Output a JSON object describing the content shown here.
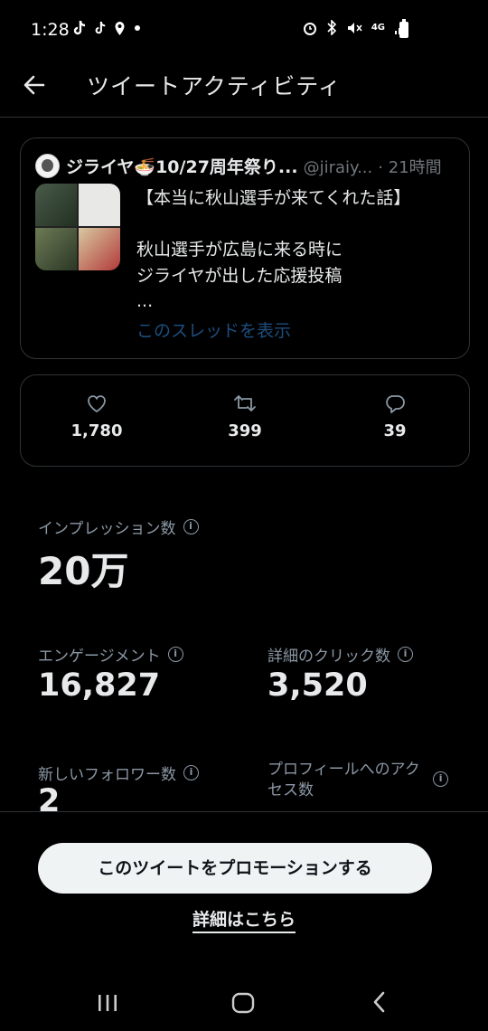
{
  "status_bar": {
    "time": "1:28",
    "left_icons": [
      "tiktok-icon",
      "tiktok-icon",
      "location-icon",
      "dot-icon"
    ],
    "right_icons": [
      "alarm-icon",
      "bluetooth-icon",
      "mute-icon",
      "4g-icon",
      "signal-icon",
      "battery-icon"
    ],
    "network": "4G"
  },
  "header": {
    "title": "ツイートアクティビティ"
  },
  "tweet": {
    "display_name": "ジライヤ🍜10/27周年祭り...",
    "handle": "@jiraiy...",
    "time": "· 21時間",
    "text": "【本当に秋山選手が来てくれた話】\n\n秋山選手が広島に来る時に\nジライヤが出した応援投稿\n...",
    "show_thread": "このスレッドを表示"
  },
  "engagement": {
    "likes": "1,780",
    "retweets": "399",
    "replies": "39"
  },
  "metrics": {
    "impressions_label": "インプレッション数",
    "impressions_value": "20万",
    "engagements_label": "エンゲージメント",
    "engagements_value": "16,827",
    "detail_clicks_label": "詳細のクリック数",
    "detail_clicks_value": "3,520",
    "new_followers_label": "新しいフォロワー数",
    "new_followers_value": "2",
    "profile_visits_label": "プロフィールへのアクセス数"
  },
  "actions": {
    "promote_label": "このツイートをプロモーションする",
    "more_label": "詳細はこちら"
  },
  "colors": {
    "background": "#000000",
    "text": "#e7e9ea",
    "muted": "#71767b",
    "link": "#1d4e7e",
    "button_bg": "#eff3f4"
  }
}
